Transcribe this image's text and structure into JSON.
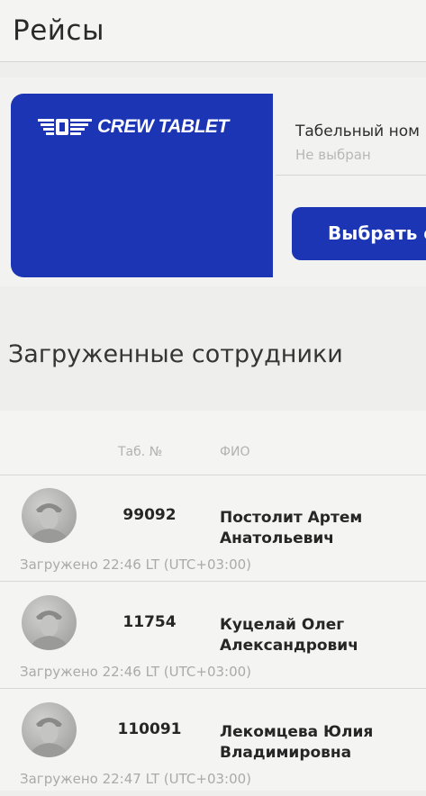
{
  "header": {
    "title": "Рейсы"
  },
  "brand": {
    "name": "CREW TABLET",
    "card_color": "#1b35b5",
    "logo_icon": "wings-logo-icon"
  },
  "employee_select": {
    "label": "Табельный ном",
    "value": "Не выбран",
    "button_label": "Выбрать с"
  },
  "loaded_section": {
    "title": "Загруженные сотрудники",
    "columns": {
      "tab_no": "Таб. №",
      "fio": "ФИО"
    },
    "rows": [
      {
        "tab_no": "99092",
        "fio_line1": "Постолит Артем",
        "fio_line2": "Анатольевич",
        "loaded": "Загружено 22:46 LT (UTC+03:00)"
      },
      {
        "tab_no": "11754",
        "fio_line1": "Куцелай Олег",
        "fio_line2": "Александрович",
        "loaded": "Загружено 22:46 LT (UTC+03:00)"
      },
      {
        "tab_no": "110091",
        "fio_line1": "Лекомцева Юлия",
        "fio_line2": "Владимировна",
        "loaded": "Загружено 22:47 LT (UTC+03:00)"
      }
    ]
  }
}
